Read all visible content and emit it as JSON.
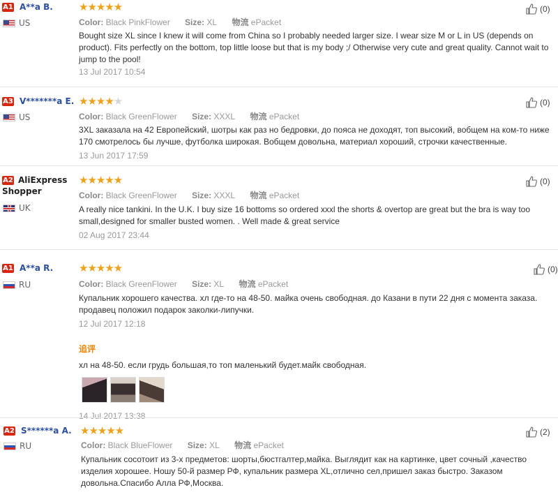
{
  "reviews": [
    {
      "level": "A1",
      "name": "A**a B.",
      "country": "US",
      "flag": "us",
      "stars": 5,
      "color_label": "Color:",
      "color": "Black PinkFlower",
      "size_label": "Size:",
      "size": "XL",
      "ship_label": "物流",
      "ship": "ePacket",
      "text": "Bought size XL since I knew it will come from China so I probably needed larger size. I wear size M or L in US (depends on product). Fits perfectly on the bottom, top little loose but that is my body ;/ Otherwise very cute and great quality. Cannot wait to jump to the pool!",
      "date": "13 Jul 2017 10:54",
      "helpful": "(0)"
    },
    {
      "level": "A3",
      "name": "V*******a E.",
      "country": "US",
      "flag": "us",
      "stars": 4,
      "color_label": "Color:",
      "color": "Black GreenFlower",
      "size_label": "Size:",
      "size": "XXXL",
      "ship_label": "物流",
      "ship": "ePacket",
      "text": "3XL заказала на 42 Европейский, шотры как раз но бедровки, до пояса не доходят, топ высокий, вобщем на ком-то ниже 170 смотрелось бы лучше, футболка широкая. Вобщем довольна, материал хороший, строчки качественные.",
      "date": "13 Jun 2017 17:59",
      "helpful": "(0)"
    },
    {
      "level": "A2",
      "name": "AliExpress Shopper",
      "country": "UK",
      "flag": "uk",
      "stars": 5,
      "color_label": "Color:",
      "color": "Black GreenFlower",
      "size_label": "Size:",
      "size": "XXXL",
      "ship_label": "物流",
      "ship": "ePacket",
      "text": "A really nice tankini. In the U.K. I buy size 16 bottoms so ordered xxxl the shorts & overtop are great but the bra is way too small,designed for smaller busted women. . Well made & great service",
      "date": "02 Aug 2017 23:44",
      "helpful": "(0)"
    },
    {
      "level": "A1",
      "name": "A**a R.",
      "country": "RU",
      "flag": "ru",
      "stars": 5,
      "color_label": "Color:",
      "color": "Black GreenFlower",
      "size_label": "Size:",
      "size": "XL",
      "ship_label": "物流",
      "ship": "ePacket",
      "text": "Купальник хорошего качества. хл где-то на 48-50. майка очень свободная. до Казани в пути 22 дня с момента заказа. продавец положил подарок заколки-липучки.",
      "date": "12 Jul 2017 12:18",
      "helpful": "(0)",
      "additional_label": "追评",
      "additional_text": "хл на 48-50. если грудь большая,то топ маленький будет.майк свободная.",
      "additional_date": "14 Jul 2017 13:38"
    },
    {
      "level": "A2",
      "name": "S******a A.",
      "country": "RU",
      "flag": "ru",
      "stars": 5,
      "color_label": "Color:",
      "color": "Black BlueFlower",
      "size_label": "Size:",
      "size": "XL",
      "ship_label": "物流",
      "ship": "ePacket",
      "text": "Купальник сосотоит из 3-х предметов: шорты,бюстгалтер,майка. Выглядит как на картинке, цвет сочный ,качество изделия хорошее. Ношу 50-й размер РФ, купальник размера XL,отлично сел,пришел заказ быстро. Заказом довольна.Спасибо Алла РФ,Москва.",
      "date": "",
      "helpful": "(2)"
    }
  ],
  "colors": {
    "accent": "#2a4fa8",
    "star": "#f2a116",
    "level_badge": "#d9260f",
    "additional": "#f08200"
  },
  "icons": {
    "helpful": "thumbs-up-icon"
  }
}
